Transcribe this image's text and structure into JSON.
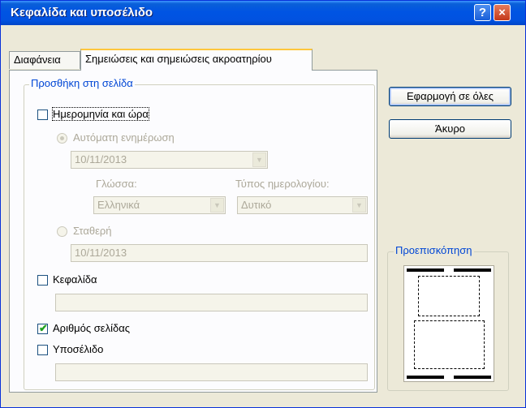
{
  "window": {
    "title": "Κεφαλίδα και υποσέλιδο",
    "help_glyph": "?",
    "close_glyph": "×"
  },
  "tabs": [
    {
      "label": "Διαφάνεια"
    },
    {
      "label": "Σημειώσεις και σημειώσεις ακροατηρίου",
      "selected": true
    }
  ],
  "group": {
    "label": "Προσθήκη στη σελίδα"
  },
  "date_time": {
    "label": "Ημερομηνία και ώρα",
    "checked": false,
    "auto_update_label": "Αυτόματη ενημέρωση",
    "auto_update_value": "10/11/2013",
    "language_label": "Γλώσσα:",
    "language_value": "Ελληνικά",
    "calendar_label": "Τύπος ημερολογίου:",
    "calendar_value": "Δυτικό",
    "fixed_label": "Σταθερή",
    "fixed_value": "10/11/2013"
  },
  "header": {
    "label": "Κεφαλίδα",
    "checked": false,
    "value": ""
  },
  "page_number": {
    "label": "Αριθμός σελίδας",
    "checked": true,
    "check_glyph": "✔"
  },
  "footer": {
    "label": "Υποσέλιδο",
    "checked": false,
    "value": ""
  },
  "buttons": {
    "apply_all": "Εφαρμογή σε όλες",
    "cancel": "Άκυρο"
  },
  "preview": {
    "label": "Προεπισκόπηση"
  },
  "colors": {
    "title_bar": "#0054e3",
    "group_label": "#0046d5",
    "dialog_bg": "#ece9d8",
    "check_mark": "#21a121"
  }
}
